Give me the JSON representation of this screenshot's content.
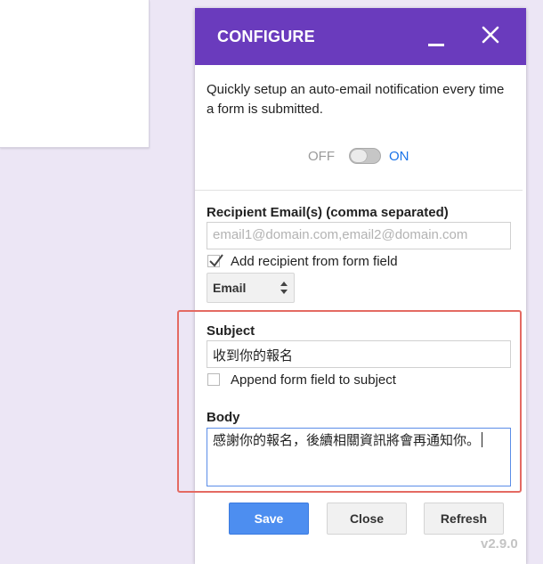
{
  "panel": {
    "title": "CONFIGURE",
    "intro": "Quickly setup an auto-email notification every time a form is submitted.",
    "toggle": {
      "off_label": "OFF",
      "on_label": "ON",
      "state": "on"
    }
  },
  "recipients": {
    "label": "Recipient Email(s) (comma separated)",
    "placeholder": "email1@domain.com,email2@domain.com",
    "add_from_field": {
      "label": "Add recipient from form field",
      "checked": true
    },
    "field_select": {
      "value": "Email"
    }
  },
  "subject": {
    "label": "Subject",
    "value": "收到你的報名",
    "append_field": {
      "label": "Append form field to subject",
      "checked": false
    }
  },
  "body": {
    "label": "Body",
    "value": "感謝你的報名，後續相關資訊將會再通知你。"
  },
  "buttons": {
    "save": "Save",
    "close": "Close",
    "refresh": "Refresh"
  },
  "version": "v2.9.0",
  "colors": {
    "header": "#6a3bbd",
    "primary_button": "#4d8ef0",
    "highlight": "#e46a62",
    "toggle_on": "#1a73e8"
  }
}
